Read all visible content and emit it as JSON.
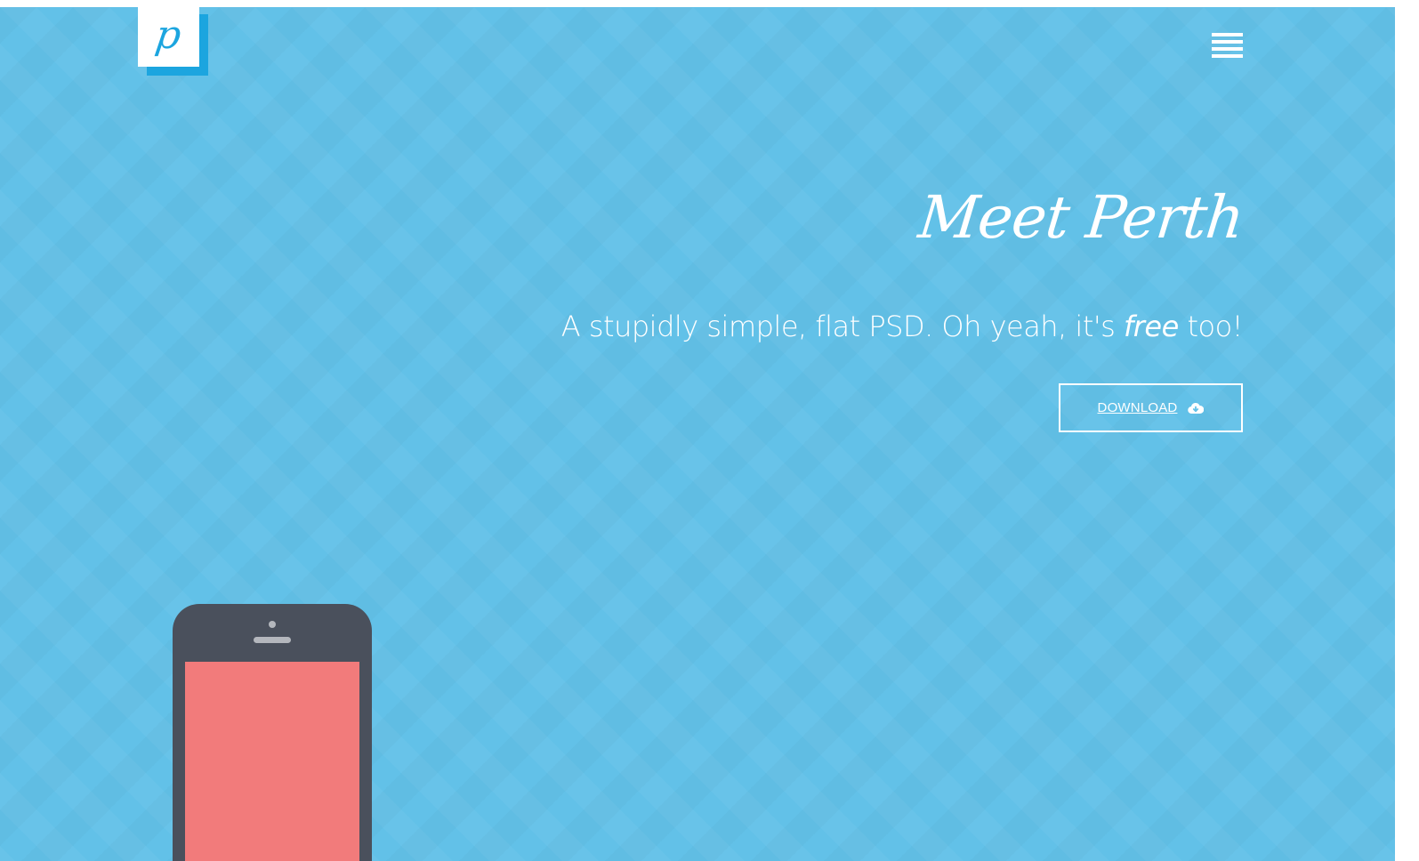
{
  "header": {
    "logo_letter": "p",
    "logo_icon": "perth-logo-icon",
    "menu_icon": "hamburger-menu-icon"
  },
  "hero": {
    "title": "Meet Perth",
    "subtitle_before": "A stupidly simple, flat PSD. Oh yeah, it's ",
    "subtitle_emphasis": "free",
    "subtitle_after": " too!",
    "download_label": "DOWNLOAD",
    "download_icon": "cloud-download-icon"
  },
  "illustration": {
    "device": "phone-illustration",
    "screen_color": "#f27b7b",
    "body_color": "#4a505c"
  },
  "colors": {
    "background": "#62c1e8",
    "accent": "#1ca5df",
    "text": "#ffffff"
  }
}
